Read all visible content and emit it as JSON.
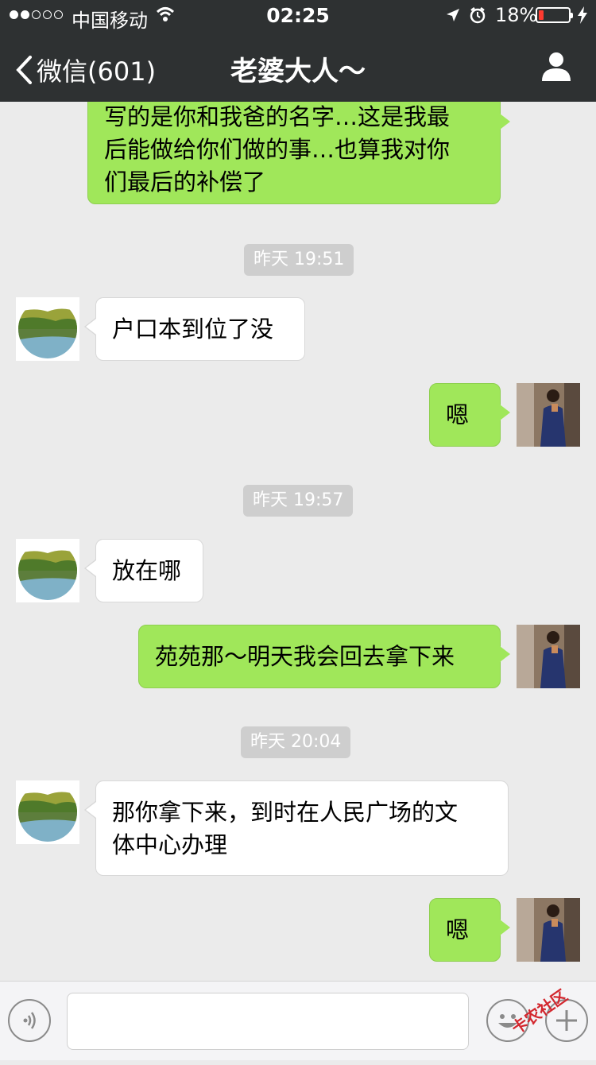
{
  "status": {
    "carrier": "中国移动",
    "time": "02:25",
    "battery_pct": "18%",
    "battery_level": 0.18,
    "battery_color": "#ff3b30"
  },
  "nav": {
    "back_label": "微信(601)",
    "title": "老婆大人～"
  },
  "colors": {
    "outgoing_bubble": "#a0e75a",
    "incoming_bubble": "#ffffff",
    "background": "#ebebeb",
    "bar": "#2e3132"
  },
  "messages": [
    {
      "dir": "out",
      "lines": [
        "写的是你和我爸的名字…这是我最",
        "后能做给你们做的事…也算我对你",
        "们最后的补偿了"
      ]
    },
    {
      "timestamp": "昨天 19:51"
    },
    {
      "dir": "in",
      "lines": [
        "户口本到位了没"
      ]
    },
    {
      "dir": "out",
      "lines": [
        "嗯"
      ]
    },
    {
      "timestamp": "昨天 19:57"
    },
    {
      "dir": "in",
      "lines": [
        "放在哪"
      ]
    },
    {
      "dir": "out",
      "lines": [
        "苑苑那～明天我会回去拿下来"
      ]
    },
    {
      "timestamp": "昨天 20:04"
    },
    {
      "dir": "in",
      "lines": [
        "那你拿下来，到时在人民广场的文",
        "体中心办理"
      ]
    },
    {
      "dir": "out",
      "lines": [
        "嗯"
      ]
    }
  ],
  "input": {
    "value": ""
  },
  "watermark": "卡农社区"
}
